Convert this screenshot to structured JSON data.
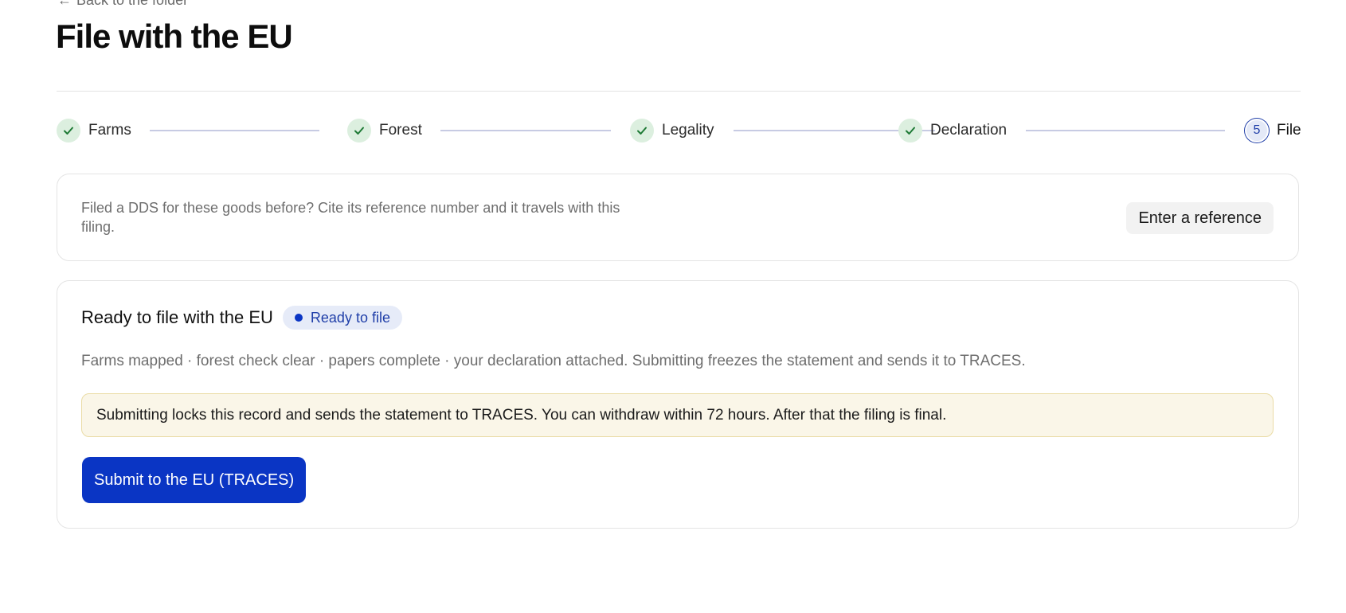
{
  "header": {
    "back_label": "Back to the folder",
    "title": "File with the EU"
  },
  "stepper": {
    "steps": [
      {
        "label": "Farms",
        "state": "done"
      },
      {
        "label": "Forest",
        "state": "done"
      },
      {
        "label": "Legality",
        "state": "done"
      },
      {
        "label": "Declaration",
        "state": "done"
      },
      {
        "label": "File",
        "number": "5",
        "state": "current"
      }
    ]
  },
  "reference": {
    "text": "Filed a DDS for these goods before? Cite its reference number and it travels with this filing.",
    "button_label": "Enter a reference"
  },
  "filing": {
    "title": "Ready to file with the EU",
    "badge": "Ready to file",
    "description": "Farms mapped · forest check clear · papers complete · your declaration attached. Submitting freezes the statement and sends it to TRACES.",
    "notice": "Submitting locks this record and sends the statement to TRACES. You can withdraw within 72 hours. After that the filing is final.",
    "submit_label": "Submit to the EU (TRACES)"
  },
  "colors": {
    "accent": "#0a35c4",
    "done_step_bg": "#dcefdf",
    "check": "#1e7a35",
    "notice_bg": "#faf6e8"
  },
  "icons": {
    "done": "check-icon",
    "back": "arrow-left-icon",
    "status": "dot-icon"
  }
}
